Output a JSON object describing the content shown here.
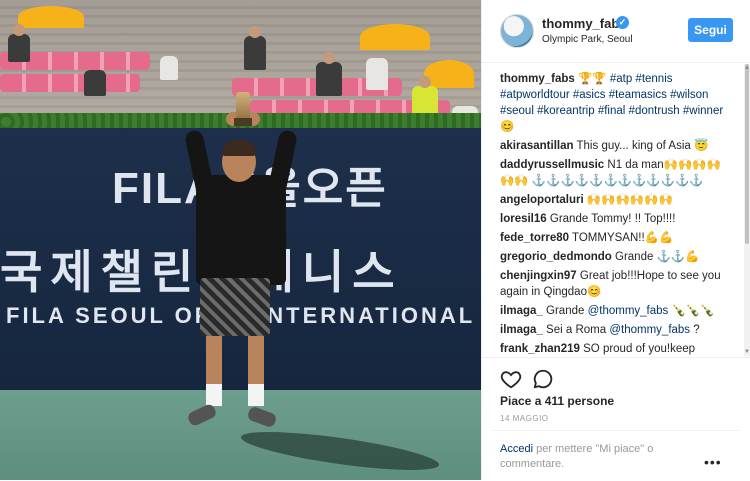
{
  "post": {
    "photo": {
      "banner_line1": "FILA서울오픈",
      "banner_line2": "국제챌린저테니스",
      "banner_line3": "FILA SEOUL OPEN INTERNATIONAL CHA"
    },
    "header": {
      "username": "thommy_fabs",
      "location": "Olympic Park, Seoul",
      "follow_label": "Segui",
      "verified_icon": "verified-badge-icon"
    },
    "comments": [
      {
        "user": "thommy_fabs",
        "text": "🏆🏆 #atp #tennis #atpworldtour #asics #teamasics #wilson #seoul #koreantrip #final #dontrush #winner 😊"
      },
      {
        "user": "akirasantillan",
        "text": "This guy... king of Asia 😇"
      },
      {
        "user": "daddyrussellmusic",
        "text": "N1 da man🙌🙌🙌🙌🙌🙌 ⚓⚓⚓⚓⚓⚓⚓⚓⚓⚓⚓⚓"
      },
      {
        "user": "angeloportaluri",
        "text": "🙌🙌🙌🙌🙌🙌"
      },
      {
        "user": "loresil16",
        "text": "Grande Tommy! !! Top!!!!"
      },
      {
        "user": "fede_torre80",
        "text": "TOMMYSAN!!💪💪"
      },
      {
        "user": "gregorio_dedmondo",
        "text": "Grande ⚓⚓💪"
      },
      {
        "user": "chenjingxin97",
        "text": "Great job!!!Hope to see you again in Qingdao😊"
      },
      {
        "user": "ilmaga_",
        "text": "Grande @thommy_fabs 🍾🍾🍾"
      },
      {
        "user": "ilmaga_",
        "text": "Sei a Roma @thommy_fabs ?"
      },
      {
        "user": "frank_zhan219",
        "text": "SO proud of you!keep"
      }
    ],
    "actions": {
      "like_icon": "heart-icon",
      "comment_icon": "comment-icon",
      "likes_text": "Piace a 411 persone",
      "date_text": "14 MAGGIO",
      "login_link": "Accedi",
      "login_rest": " per mettere \"Mi piace\" o commentare.",
      "more_label": "•••"
    }
  },
  "colors": {
    "accent": "#3897f0",
    "link": "#003569",
    "muted": "#999999",
    "text": "#262626"
  }
}
